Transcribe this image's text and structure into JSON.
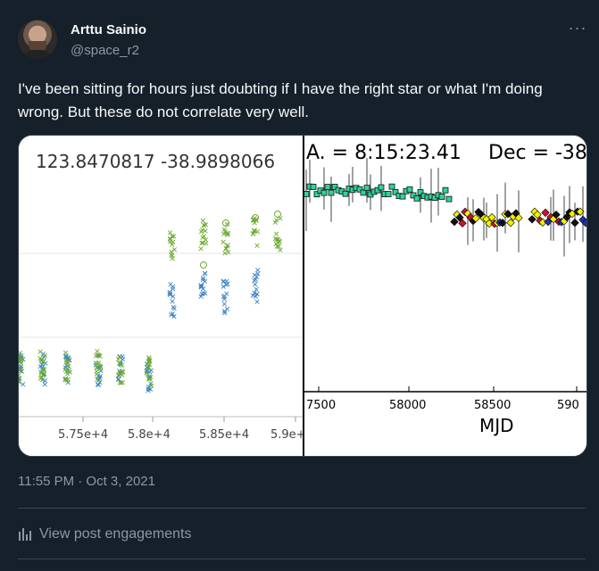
{
  "author": {
    "name": "Arttu Sainio",
    "handle": "@space_r2"
  },
  "tweet": {
    "text": "I've been sitting for hours just doubting if I have the right star or what I'm doing wrong. But these do not correlate very well.",
    "timestamp": "11:55 PM · Oct 3, 2021",
    "engagements_label": "View post engagements"
  },
  "left_plot": {
    "title": "123.8470817 -38.9898066",
    "xticks": [
      "5.75e+4",
      "5.8e+4",
      "5.85e+4",
      "5.9e+"
    ]
  },
  "right_plot": {
    "title_left": "A. = 8:15:23.41",
    "title_right": "Dec = -38",
    "xticks": [
      "7500",
      "58000",
      "58500",
      "590"
    ],
    "xlabel": "MJD"
  },
  "colors": {
    "bg": "#15202b",
    "muted": "#8b98a5",
    "green_series": "#6aab2e",
    "blue_series": "#3b82c4",
    "teal_series": "#2fd39a",
    "yellow_series": "#f3f000"
  },
  "icons": {
    "more": "more-horizontal-icon",
    "engagements": "bar-chart-icon"
  }
}
